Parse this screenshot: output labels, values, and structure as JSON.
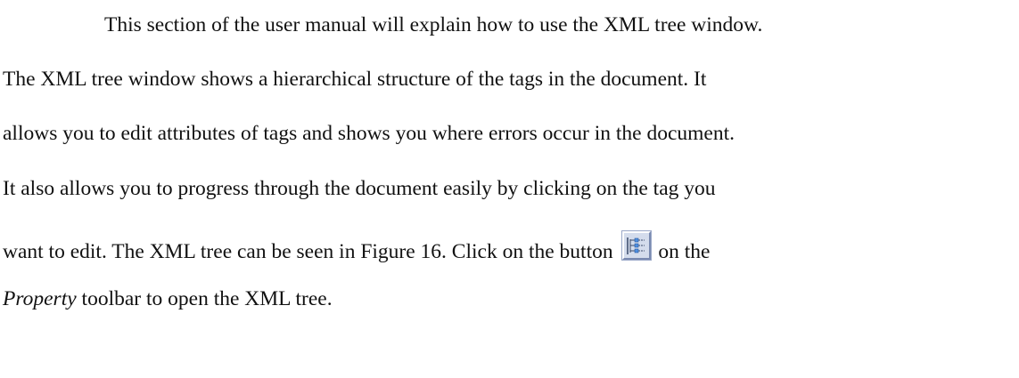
{
  "paragraph": {
    "line1": "This section of the user manual will explain how to use the XML tree window.",
    "line2": "The XML tree window shows a hierarchical structure of the tags in the document.  It",
    "line3": "allows you to edit attributes of tags and shows you where errors occur in the document.",
    "line4": "It also allows you to progress through the document easily by clicking on the tag you",
    "line5_before": "want to edit.  The XML tree can be seen in Figure 16.  Click on the button",
    "line5_after": "on the",
    "line6_italic": "Property",
    "line6_rest": " toolbar to open the XML tree."
  },
  "icons": {
    "xml_tree_button": "xml-tree-icon"
  }
}
